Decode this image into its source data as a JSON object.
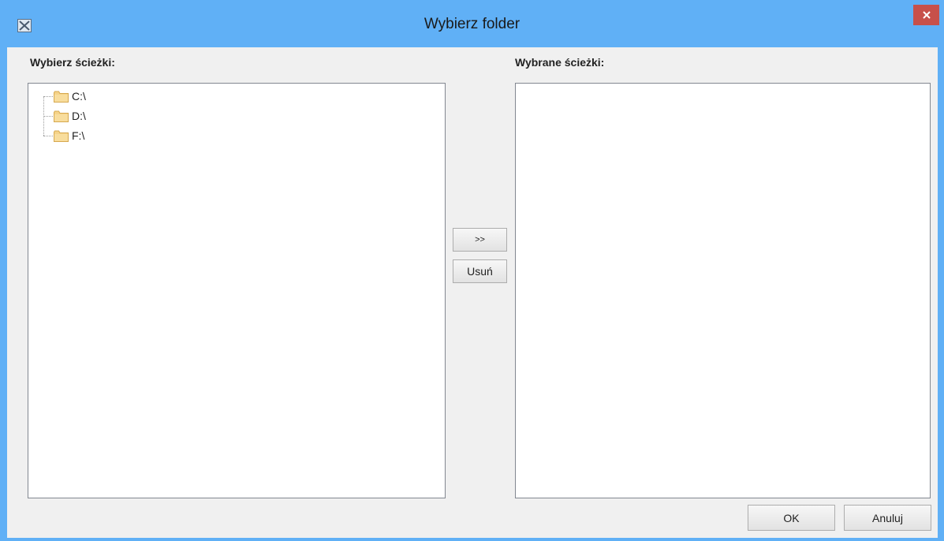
{
  "window": {
    "title": "Wybierz folder",
    "accent_color": "#60b0f6",
    "close_color": "#c7504a"
  },
  "left_panel": {
    "label": "Wybierz ścieżki:",
    "tree": [
      {
        "label": "C:\\",
        "icon": "folder-icon"
      },
      {
        "label": "D:\\",
        "icon": "folder-icon"
      },
      {
        "label": "F:\\",
        "icon": "folder-icon"
      }
    ]
  },
  "right_panel": {
    "label": "Wybrane ścieżki:",
    "items": []
  },
  "buttons": {
    "add": ">>",
    "remove": "Usuń",
    "ok": "OK",
    "cancel": "Anuluj"
  }
}
